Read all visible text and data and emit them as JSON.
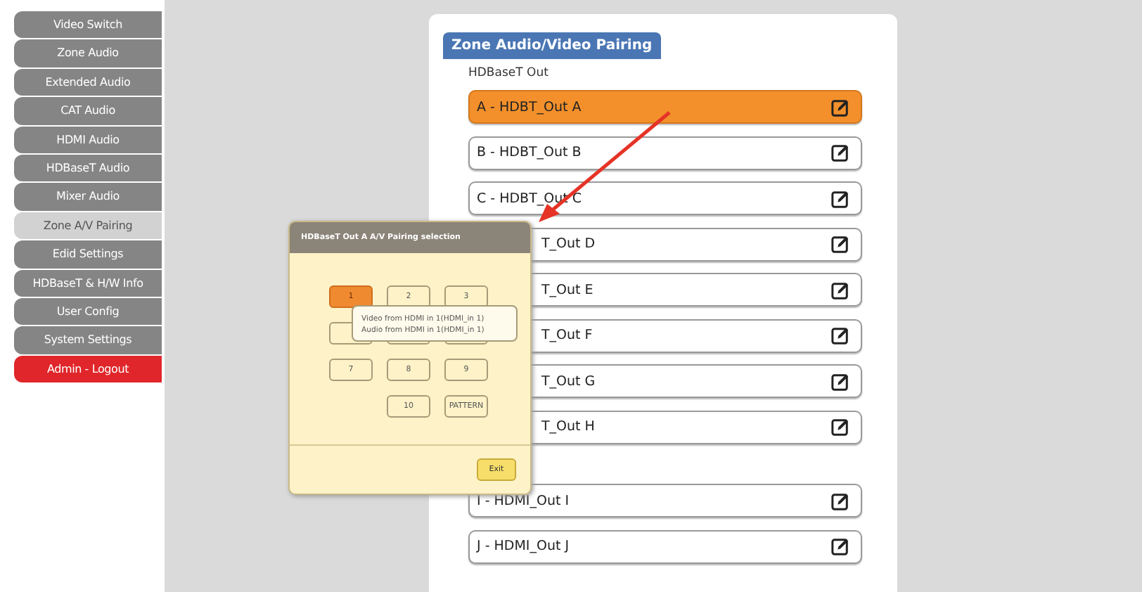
{
  "sidebar": {
    "items": [
      {
        "label": "Video Switch",
        "kind": "menu",
        "selected": false
      },
      {
        "label": "Zone Audio",
        "kind": "menu",
        "selected": false
      },
      {
        "label": "Extended Audio",
        "kind": "menu",
        "selected": false
      },
      {
        "label": "CAT Audio",
        "kind": "menu",
        "selected": false
      },
      {
        "label": "HDMI Audio",
        "kind": "menu",
        "selected": false
      },
      {
        "label": "HDBaseT Audio",
        "kind": "menu",
        "selected": false
      },
      {
        "label": "Mixer Audio",
        "kind": "menu",
        "selected": false
      },
      {
        "label": "Zone A/V Pairing",
        "kind": "menu",
        "selected": true
      },
      {
        "label": "Edid Settings",
        "kind": "menu",
        "selected": false
      },
      {
        "label": "HDBaseT & H/W Info",
        "kind": "menu",
        "selected": false
      },
      {
        "label": "User Config",
        "kind": "menu",
        "selected": false
      },
      {
        "label": "System Settings",
        "kind": "menu",
        "selected": false
      },
      {
        "label": "Admin - Logout",
        "kind": "logout",
        "selected": false
      }
    ]
  },
  "panel": {
    "title": "Zone Audio/Video Pairing",
    "section_label": "HDBaseT Out",
    "outputs": [
      {
        "label": "A - HDBT_Out A",
        "selected": true,
        "covered": false
      },
      {
        "label": "B - HDBT_Out B",
        "selected": false,
        "covered": false
      },
      {
        "label": "C - HDBT_Out C",
        "selected": false,
        "covered": false
      },
      {
        "label": "T_Out D",
        "selected": false,
        "covered": true
      },
      {
        "label": "T_Out E",
        "selected": false,
        "covered": true
      },
      {
        "label": "T_Out F",
        "selected": false,
        "covered": true
      },
      {
        "label": "T_Out G",
        "selected": false,
        "covered": true
      },
      {
        "label": "T_Out H",
        "selected": false,
        "covered": true
      },
      {
        "label": "I - HDMI_Out I",
        "selected": false,
        "covered": false,
        "gap_before": true
      },
      {
        "label": "J - HDMI_Out J",
        "selected": false,
        "covered": false
      }
    ]
  },
  "dialog": {
    "title": "HDBaseT Out A A/V Pairing selection",
    "keys": [
      {
        "kind": "key",
        "label": "1",
        "selected": true
      },
      {
        "kind": "key",
        "label": "2",
        "selected": false
      },
      {
        "kind": "key",
        "label": "3",
        "selected": false
      },
      {
        "kind": "covered"
      },
      {
        "kind": "covered"
      },
      {
        "kind": "covered"
      },
      {
        "kind": "key",
        "label": "7",
        "selected": false
      },
      {
        "kind": "key",
        "label": "8",
        "selected": false
      },
      {
        "kind": "key",
        "label": "9",
        "selected": false
      },
      {
        "kind": "blank"
      },
      {
        "kind": "key",
        "label": "10",
        "selected": false
      },
      {
        "kind": "key",
        "label": "PATTERN",
        "selected": false
      }
    ],
    "tooltip": [
      "Video from HDMI in 1(HDMI_in 1)",
      "Audio from HDMI in 1(HDMI_in 1)"
    ],
    "exit_button": "Exit"
  }
}
